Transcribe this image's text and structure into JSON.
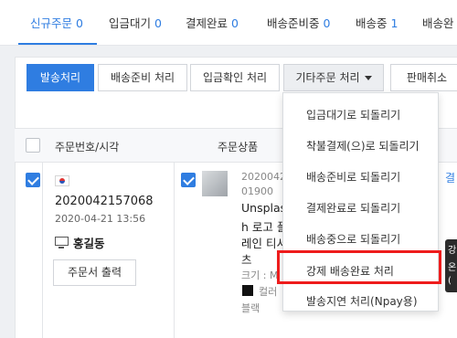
{
  "tabs": [
    {
      "label": "신규주문",
      "count": "0"
    },
    {
      "label": "입금대기",
      "count": "0"
    },
    {
      "label": "결제완료",
      "count": "0"
    },
    {
      "label": "배송준비중",
      "count": "0"
    },
    {
      "label": "배송중",
      "count": "1"
    },
    {
      "label": "배송완"
    }
  ],
  "toolbar": {
    "ship": "발송처리",
    "prepare": "배송준비 처리",
    "confirm_payment": "입금확인 처리",
    "other": "기타주문 처리",
    "cancel": "판매취소"
  },
  "table": {
    "headers": {
      "order": "주문번호/시각",
      "product": "주문상품"
    }
  },
  "order": {
    "number": "2020042157068",
    "datetime": "2020-04-21 13:56",
    "buyer": "홍길동",
    "print": "주문서 출력"
  },
  "product": {
    "line1": "2020042",
    "line2": "01900",
    "name_lines": [
      "Unsplas",
      "h 로고 플",
      "레인 티서",
      "츠"
    ],
    "size": "크기 : M",
    "color": "컬러",
    "color_value": "블랙",
    "side_link": "결"
  },
  "dropdown": {
    "items": [
      "입금대기로 되돌리기",
      "착불결제(으)로 되돌리기",
      "배송준비로 되돌리기",
      "결제완료로 되돌리기",
      "배송중으로 되돌리기",
      "강제 배송완료 처리",
      "발송지연 처리(Npay용)"
    ]
  },
  "tooltip": {
    "lines": [
      "강",
      "온",
      "("
    ]
  },
  "colors": {
    "accent": "#2f7de1",
    "highlight": "#ee1c1c"
  }
}
